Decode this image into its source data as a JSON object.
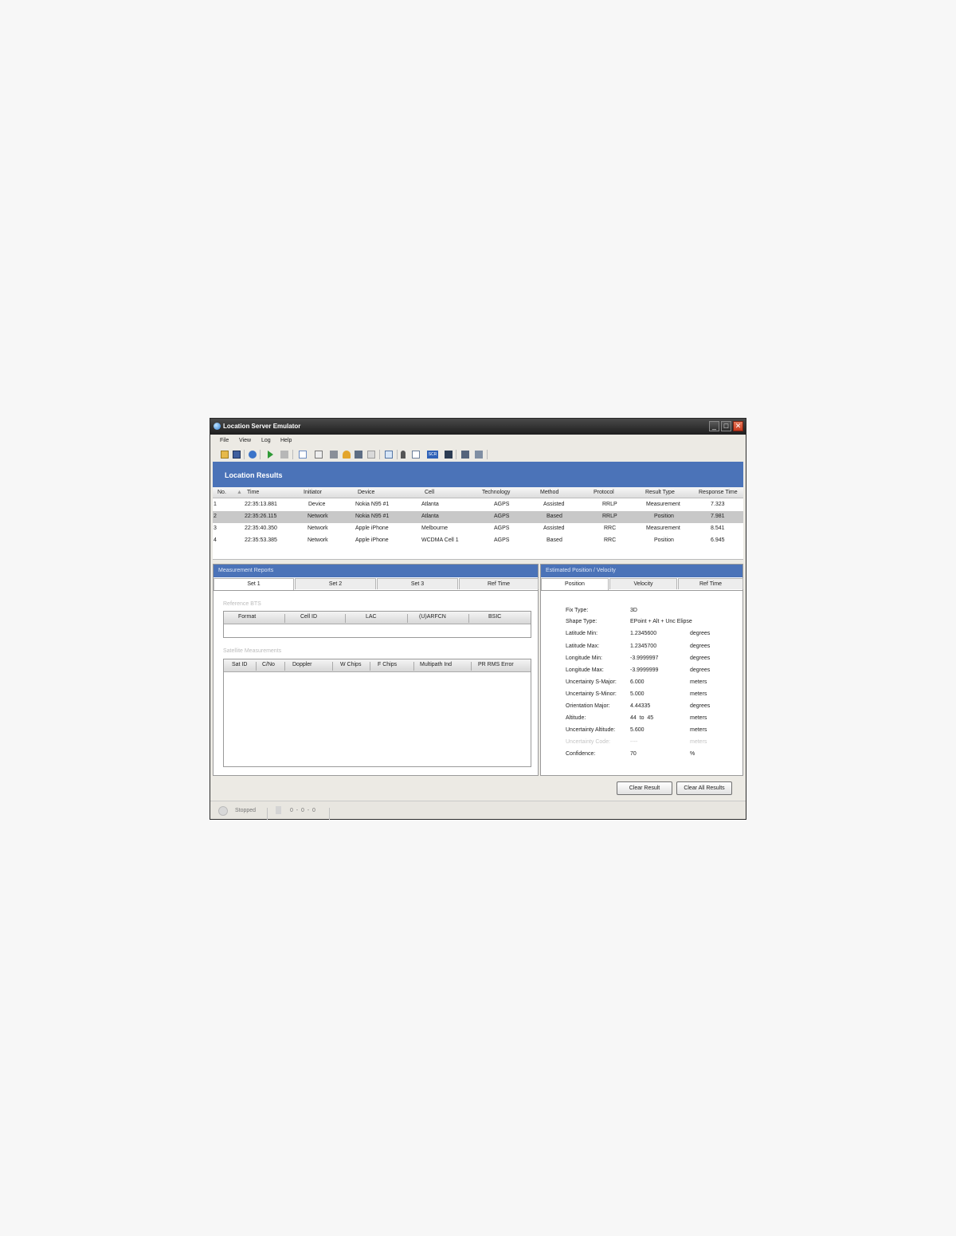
{
  "window": {
    "title": "Location Server Emulator"
  },
  "menu": [
    "File",
    "View",
    "Log",
    "Help"
  ],
  "toolbar": {
    "icons": [
      "open-folder-icon",
      "save-icon",
      "help-icon",
      "play-icon",
      "stop-icon",
      "table-icon",
      "document-icon",
      "grid-icon",
      "bell-icon",
      "map-icon",
      "print-icon",
      "search-icon",
      "person-icon",
      "chart-icon",
      "scr-icon",
      "window-icon",
      "export-icon",
      "settings-icon"
    ],
    "scr_label": "SCR"
  },
  "results": {
    "title": "Location Results",
    "columns": [
      "No.",
      "Time",
      "Initiator",
      "Device",
      "Cell",
      "Technology",
      "Method",
      "Protocol",
      "Result Type",
      "Response Time"
    ],
    "sort_indicator": "▲",
    "rows": [
      [
        "1",
        "22:35:13.881",
        "Device",
        "Nokia N95 #1",
        "Atlanta",
        "AGPS",
        "Assisted",
        "RRLP",
        "Measurement",
        "7.323"
      ],
      [
        "2",
        "22:35:26.115",
        "Network",
        "Nokia N95 #1",
        "Atlanta",
        "AGPS",
        "Based",
        "RRLP",
        "Position",
        "7.981"
      ],
      [
        "3",
        "22:35:40.350",
        "Network",
        "Apple iPhone",
        "Melbourne",
        "AGPS",
        "Assisted",
        "RRC",
        "Measurement",
        "8.541"
      ],
      [
        "4",
        "22:35:53.385",
        "Network",
        "Apple iPhone",
        "WCDMA Cell 1",
        "AGPS",
        "Based",
        "RRC",
        "Position",
        "6.945"
      ]
    ],
    "selected_row": 2
  },
  "measurement": {
    "title": "Measurement Reports",
    "tabs": [
      "Set 1",
      "Set 2",
      "Set 3",
      "Ref Time"
    ],
    "reference_bts_label": "Reference BTS",
    "bts_columns": [
      "Format",
      "Cell ID",
      "LAC",
      "(U)ARFCN",
      "BSIC"
    ],
    "satellite_label": "Satellite Measurements",
    "sat_columns": [
      "Sat ID",
      "C/No",
      "Doppler",
      "W Chips",
      "F Chips",
      "Multipath Ind",
      "PR RMS Error"
    ]
  },
  "estimate": {
    "title": "Estimated Position / Velocity",
    "tabs": [
      "Position",
      "Velocity",
      "Ref Time"
    ],
    "fields": [
      {
        "label": "Fix Type:",
        "value": "3D",
        "unit": ""
      },
      {
        "label": "Shape Type:",
        "value": "EPoint + Alt + Unc Elipse",
        "unit": ""
      },
      {
        "label": "Latitude Min:",
        "value": "1.2345600",
        "unit": "degrees"
      },
      {
        "label": "Latitude Max:",
        "value": "1.2345700",
        "unit": "degrees"
      },
      {
        "label": "Longitude Min:",
        "value": "-3.9999997",
        "unit": "degrees"
      },
      {
        "label": "Longitude Max:",
        "value": "-3.9999999",
        "unit": "degrees"
      },
      {
        "label": "Uncertainty S-Major:",
        "value": "6.000",
        "unit": "meters"
      },
      {
        "label": "Uncertainty S-Minor:",
        "value": "5.000",
        "unit": "meters"
      },
      {
        "label": "Orientation Major:",
        "value": "4.44335",
        "unit": "degrees"
      },
      {
        "label": "Altitude:",
        "value": "44  to  45",
        "unit": "meters"
      },
      {
        "label": "Uncertainty Altitude:",
        "value": "5.600",
        "unit": "meters"
      },
      {
        "label": "Uncertainty Code:",
        "value": "----",
        "unit": "meters"
      },
      {
        "label": "Confidence:",
        "value": "70",
        "unit": "%"
      }
    ]
  },
  "buttons": {
    "clear_result": "Clear Result",
    "clear_all": "Clear All Results"
  },
  "status": {
    "state": "Stopped",
    "counts": "0  -  0  -  0"
  },
  "colors": {
    "banner": "#4b73b8",
    "selected_row": "#c8c8c8",
    "close_button": "#d0482a"
  }
}
